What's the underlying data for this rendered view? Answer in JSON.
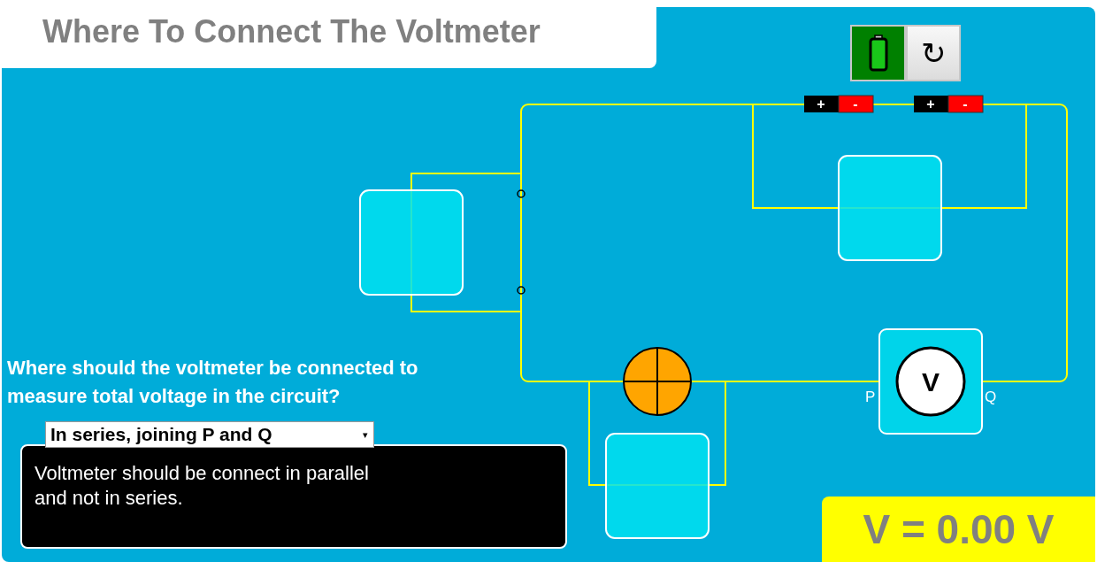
{
  "title": "Where To Connect The Voltmeter",
  "toolbar": {
    "power": {
      "on": true
    },
    "reset": {
      "label": "↻"
    }
  },
  "circuit": {
    "batteries": [
      {
        "positive": "+",
        "negative": "-"
      },
      {
        "positive": "+",
        "negative": "-"
      }
    ],
    "voltmeter": {
      "label": "V",
      "left_terminal": "P",
      "right_terminal": "Q"
    }
  },
  "question": "Where should the voltmeter be connected to measure total voltage in the circuit?",
  "answer_select": {
    "value": "In series, joining P and Q",
    "arrow": "▾"
  },
  "feedback": "Voltmeter should be connect in parallel and not in series.",
  "reading": "V = 0.00 V"
}
